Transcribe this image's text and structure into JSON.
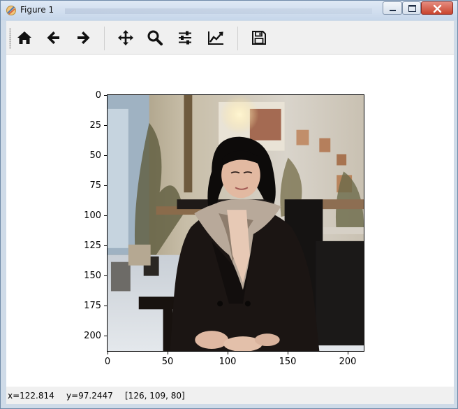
{
  "window": {
    "title": "Figure 1"
  },
  "toolbar": {
    "buttons": [
      {
        "name": "home-button",
        "icon": "home-icon",
        "tooltip": "Reset original view"
      },
      {
        "name": "back-button",
        "icon": "arrow-left-icon",
        "tooltip": "Back"
      },
      {
        "name": "forward-button",
        "icon": "arrow-right-icon",
        "tooltip": "Forward"
      },
      {
        "name": "pan-button",
        "icon": "move-icon",
        "tooltip": "Pan"
      },
      {
        "name": "zoom-button",
        "icon": "magnifier-icon",
        "tooltip": "Zoom"
      },
      {
        "name": "configure-subplots-button",
        "icon": "sliders-icon",
        "tooltip": "Configure subplots"
      },
      {
        "name": "edit-axis-button",
        "icon": "line-chart-icon",
        "tooltip": "Edit axis"
      },
      {
        "name": "save-button",
        "icon": "floppy-disk-icon",
        "tooltip": "Save"
      }
    ]
  },
  "axes": {
    "yticks": [
      "0",
      "25",
      "50",
      "75",
      "100",
      "125",
      "150",
      "175",
      "200"
    ],
    "xticks": [
      "0",
      "50",
      "100",
      "150",
      "200"
    ],
    "image_extent": 214,
    "image_description": "photo-woman-black-coat-scarf-cafe"
  },
  "status": {
    "x": "x=122.814",
    "y": "y=97.2447",
    "pixel": "[126, 109, 80]"
  }
}
